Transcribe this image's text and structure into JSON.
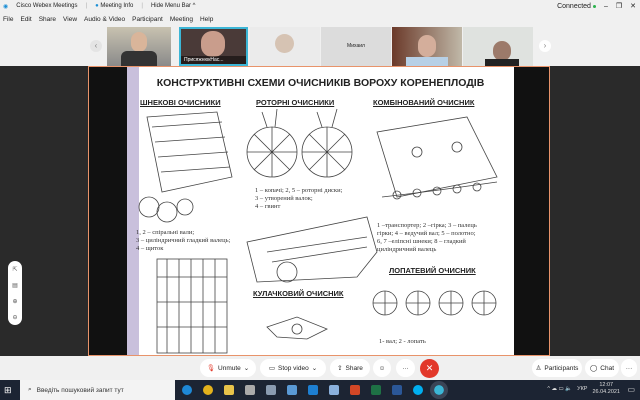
{
  "titlebar": {
    "app": "Cisco Webex Meetings",
    "meeting_info": "Meeting Info",
    "hide_menu": "Hide Menu Bar ^",
    "status": "Connected",
    "min": "–",
    "restore": "❐",
    "close": "✕"
  },
  "menu": [
    "File",
    "Edit",
    "Share",
    "View",
    "Audio & Video",
    "Participant",
    "Meeting",
    "Help"
  ],
  "participants": {
    "active_name": "ПрисяжнюкНас...",
    "name_tile": "Михаил",
    "prev": "‹",
    "next": "›"
  },
  "slide": {
    "title": "КОНСТРУКТИВНІ СХЕМИ ОЧИСНИКІВ ВОРОХУ КОРЕНЕПЛОДІВ",
    "sections": {
      "screw": "ШНЕКОВІ ОЧИСНИКИ",
      "rotor": "РОТОРНІ ОЧИСНИКИ",
      "combined": "КОМБІНОВАНИЙ ОЧИСНИК",
      "cam": "КУЛАЧКОВИЙ ОЧИСНИК",
      "blade": "ЛОПАТЕВИЙ ОЧИСНИК"
    },
    "captions": {
      "screw": [
        "1, 2 – спіральні вали;",
        "3 – циліндричний гладкий валець;",
        "4 – щиток"
      ],
      "rotor": [
        "1 – копачі; 2, 5 – роторні диски;",
        "3 – утворений валок;",
        "4 – гвинт"
      ],
      "combined": [
        "1 –транспортер; 2 –гірка; 3 – палець",
        "гірки; 4 – ведучий вал; 5 – полотно;",
        "6, 7 –еліпсні шнеки; 8 – гладкий",
        "циліндричний валець"
      ],
      "blade": "1- вал; 2 - лопать"
    }
  },
  "controls": {
    "unmute": "Unmute",
    "stop_video": "Stop video",
    "share": "Share",
    "more": "···",
    "participants": "Participants",
    "chat": "Chat"
  },
  "taskbar": {
    "search_placeholder": "Введіть пошуковий запит тут",
    "lang": "УКР",
    "time": "12:07",
    "date": "26.04.2021"
  }
}
